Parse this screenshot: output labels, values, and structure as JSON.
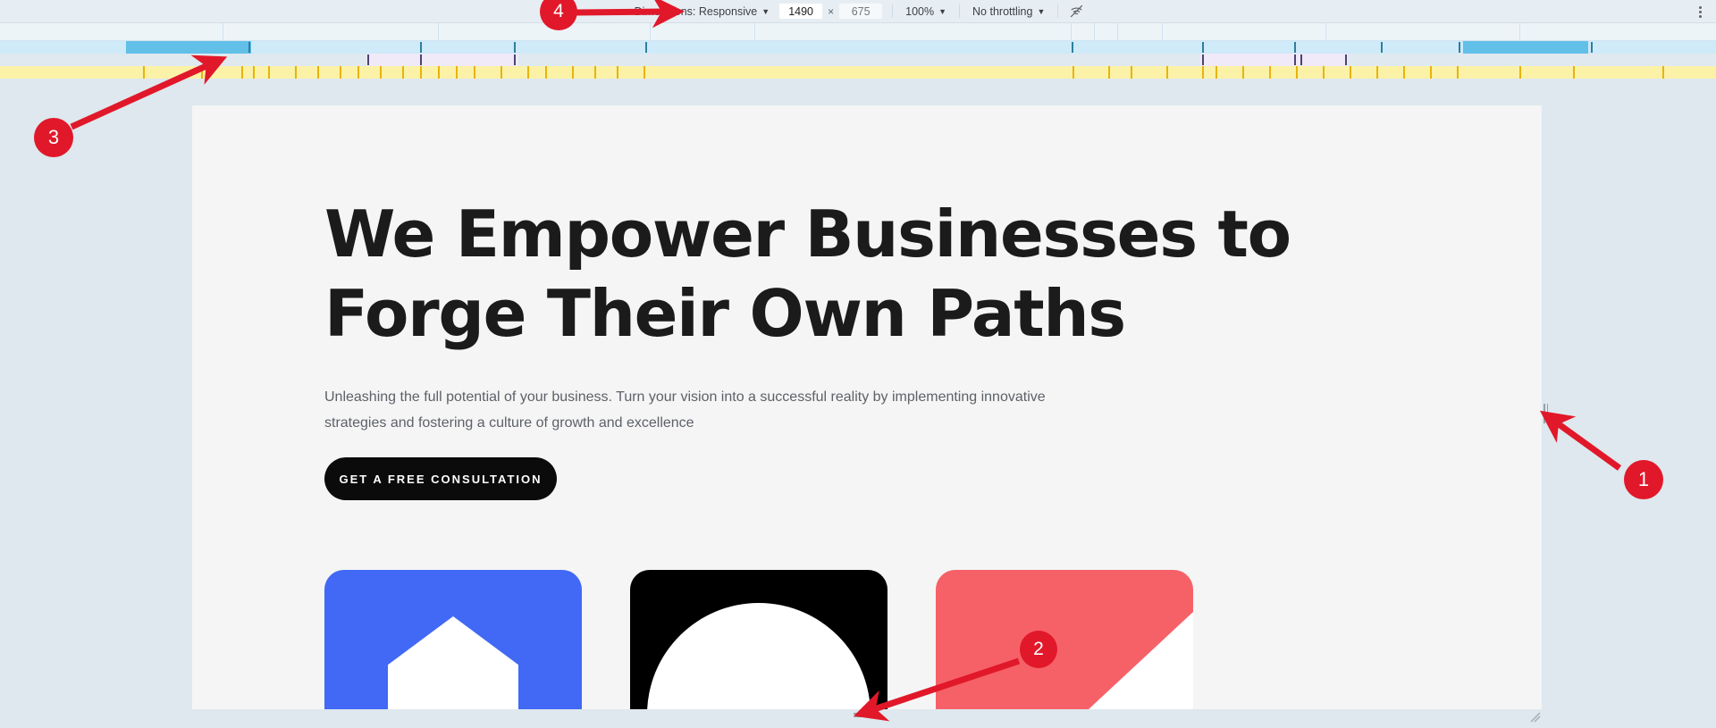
{
  "device_toolbar": {
    "dimensions_label": "Dimensions: Responsive",
    "caret": "▼",
    "width_value": "1490",
    "height_value": "675",
    "height_placeholder": "675",
    "times_symbol": "×",
    "zoom_label": "100%",
    "throttling_label": "No throttling",
    "wifi_off_icon": "wifi-off-icon",
    "overflow_icon": "more-vertical-icon"
  },
  "rulers": {
    "blue_track_label": "frames-track",
    "purple_track_label": "scripting-track",
    "yellow_track_label": "network-track"
  },
  "page": {
    "heading": "We Empower Businesses to Forge Their Own Paths",
    "paragraph": "Unleashing the full potential of your business. Turn your vision into a successful reality by implementing innovative strategies and fostering a culture of growth and excellence",
    "cta_label": "GET A FREE CONSULTATION",
    "cards": [
      {
        "name": "card-house",
        "color": "#4169f5",
        "glyph": "house-shape"
      },
      {
        "name": "card-arch",
        "color": "#000000",
        "glyph": "arch-shape"
      },
      {
        "name": "card-triangle",
        "color": "#f66168",
        "glyph": "triangle-shape"
      }
    ]
  },
  "handles": {
    "right": "resize-width-handle",
    "bottom": "resize-height-handle",
    "corner": "resize-corner-handle"
  },
  "annotations": [
    {
      "id": "1",
      "label": "1"
    },
    {
      "id": "2",
      "label": "2"
    },
    {
      "id": "3",
      "label": "3"
    },
    {
      "id": "4",
      "label": "4"
    }
  ],
  "colors": {
    "toolbar_bg": "#e7eef3",
    "page_bg": "#f5f5f5",
    "outer_bg": "#dee8ee",
    "annotation_red": "#e1182a",
    "blue_card": "#4169f5",
    "coral_card": "#f66168"
  }
}
